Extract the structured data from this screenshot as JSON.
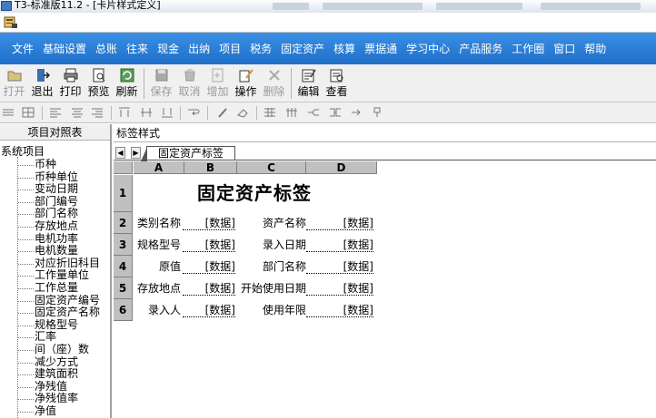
{
  "window": {
    "title": "T3-标准版11.2 - [卡片样式定义]"
  },
  "menu": [
    "文件",
    "基础设置",
    "总账",
    "往来",
    "现金",
    "出纳",
    "项目",
    "税务",
    "固定资产",
    "核算",
    "票据通",
    "学习中心",
    "产品服务",
    "工作圈",
    "窗口",
    "帮助"
  ],
  "toolbar": {
    "items": [
      {
        "label": "打开",
        "icon": "open-folder-icon",
        "disabled": true
      },
      {
        "label": "退出",
        "icon": "exit-door-icon",
        "disabled": false
      },
      {
        "label": "打印",
        "icon": "printer-icon",
        "disabled": false
      },
      {
        "label": "预览",
        "icon": "preview-icon",
        "disabled": false
      },
      {
        "label": "刷新",
        "icon": "refresh-icon",
        "disabled": false
      },
      {
        "label": "保存",
        "icon": "save-disk-icon",
        "disabled": true
      },
      {
        "label": "取消",
        "icon": "cancel-icon",
        "disabled": true
      },
      {
        "label": "增加",
        "icon": "add-icon",
        "disabled": true
      },
      {
        "label": "操作",
        "icon": "operate-pencil-icon",
        "disabled": false
      },
      {
        "label": "删除",
        "icon": "delete-x-icon",
        "disabled": true
      },
      {
        "label": "编辑",
        "icon": "edit-icon",
        "disabled": false
      },
      {
        "label": "查看",
        "icon": "view-icon",
        "disabled": false
      }
    ]
  },
  "left_panel": {
    "header": "项目对照表",
    "root": "系统项目",
    "items": [
      "币种",
      "币种单位",
      "变动日期",
      "部门编号",
      "部门名称",
      "存放地点",
      "电机功率",
      "电机数量",
      "对应折旧科目",
      "工作量单位",
      "工作总量",
      "固定资产编号",
      "固定资产名称",
      "规格型号",
      "汇率",
      "间（座）数",
      "减少方式",
      "建筑面积",
      "净残值",
      "净残值率",
      "净值"
    ]
  },
  "right_panel": {
    "name_field": "标签样式",
    "tab_label": "固定资产标签",
    "columns": [
      "A",
      "B",
      "C",
      "D"
    ],
    "rows": [
      "1",
      "2",
      "3",
      "4",
      "5",
      "6"
    ],
    "card_title": "固定资产标签",
    "fields": [
      {
        "label": "类别名称",
        "value": "[数据]"
      },
      {
        "label": "资产名称",
        "value": "[数据]"
      },
      {
        "label": "规格型号",
        "value": "[数据]"
      },
      {
        "label": "录入日期",
        "value": "[数据]"
      },
      {
        "label": "原值",
        "value": "[数据]"
      },
      {
        "label": "部门名称",
        "value": "[数据]"
      },
      {
        "label": "存放地点",
        "value": "[数据]"
      },
      {
        "label": "开始使用日期",
        "value": "[数据]"
      },
      {
        "label": "录入人",
        "value": "[数据]"
      },
      {
        "label": "使用年限",
        "value": "[数据]"
      }
    ]
  },
  "colors": {
    "menu_bar": "#2a7fd6",
    "header_gray": "#c0c0c0"
  }
}
